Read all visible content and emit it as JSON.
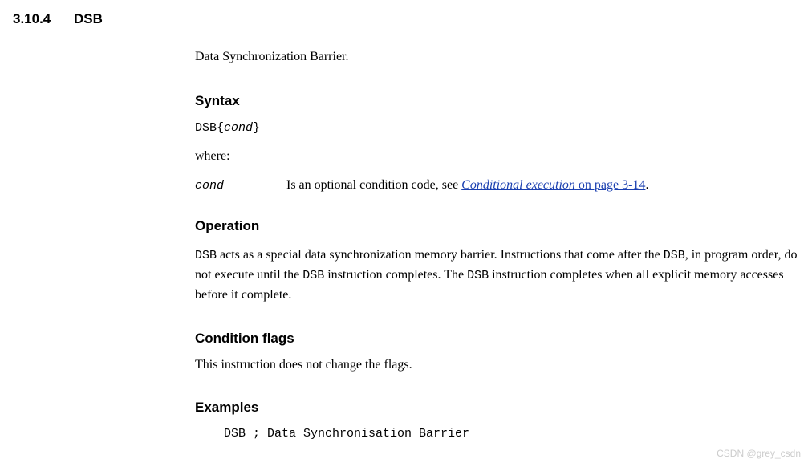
{
  "header": {
    "number": "3.10.4",
    "title": "DSB"
  },
  "intro": "Data Synchronization Barrier.",
  "syntax": {
    "heading": "Syntax",
    "mnemonic": "DSB",
    "brace_open": "{",
    "param": "cond",
    "brace_close": "}",
    "where": "where:",
    "cond_label": "cond",
    "cond_desc_pre": "Is an optional condition code, see ",
    "cond_link_italic": "Conditional execution",
    "cond_link_rest": " on page 3-14",
    "cond_desc_post": "."
  },
  "operation": {
    "heading": "Operation",
    "p1a": "DSB",
    "p1b": " acts as a special data synchronization memory barrier. Instructions that come after the ",
    "p1c": "DSB",
    "p1d": ", in program order, do not execute until the ",
    "p1e": "DSB",
    "p1f": " instruction completes. The ",
    "p1g": "DSB",
    "p1h": " instruction completes when all explicit memory accesses before it complete."
  },
  "condflags": {
    "heading": "Condition flags",
    "text": "This instruction does not change the flags."
  },
  "examples": {
    "heading": "Examples",
    "code": "DSB ; Data Synchronisation Barrier"
  },
  "watermark": "CSDN @grey_csdn"
}
